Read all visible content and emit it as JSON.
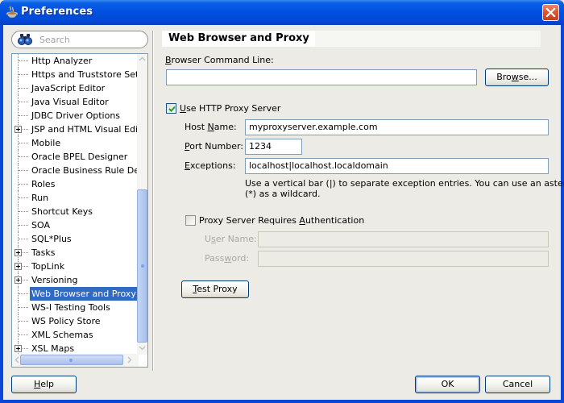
{
  "window": {
    "title": "Preferences",
    "icon": "java-coffee-cup-icon",
    "close_icon": "close-icon"
  },
  "search": {
    "placeholder": "Search",
    "icon": "binoculars-icon"
  },
  "tree": {
    "items": [
      {
        "label": "Http Analyzer",
        "expandable": false,
        "selected": false
      },
      {
        "label": "Https and Truststore Settin",
        "expandable": false,
        "selected": false
      },
      {
        "label": "JavaScript Editor",
        "expandable": false,
        "selected": false
      },
      {
        "label": "Java Visual Editor",
        "expandable": false,
        "selected": false
      },
      {
        "label": "JDBC Driver Options",
        "expandable": false,
        "selected": false
      },
      {
        "label": "JSP and HTML Visual Editor",
        "expandable": true,
        "selected": false
      },
      {
        "label": "Mobile",
        "expandable": false,
        "selected": false
      },
      {
        "label": "Oracle BPEL Designer",
        "expandable": false,
        "selected": false
      },
      {
        "label": "Oracle Business Rule Design",
        "expandable": false,
        "selected": false
      },
      {
        "label": "Roles",
        "expandable": false,
        "selected": false
      },
      {
        "label": "Run",
        "expandable": false,
        "selected": false
      },
      {
        "label": "Shortcut Keys",
        "expandable": false,
        "selected": false
      },
      {
        "label": "SOA",
        "expandable": false,
        "selected": false
      },
      {
        "label": "SQL*Plus",
        "expandable": false,
        "selected": false
      },
      {
        "label": "Tasks",
        "expandable": true,
        "selected": false
      },
      {
        "label": "TopLink",
        "expandable": true,
        "selected": false
      },
      {
        "label": "Versioning",
        "expandable": true,
        "selected": false
      },
      {
        "label": "Web Browser and Proxy",
        "expandable": false,
        "selected": true
      },
      {
        "label": "WS-I Testing Tools",
        "expandable": false,
        "selected": false
      },
      {
        "label": "WS Policy Store",
        "expandable": false,
        "selected": false
      },
      {
        "label": "XML Schemas",
        "expandable": false,
        "selected": false
      },
      {
        "label": "XSL Maps",
        "expandable": true,
        "selected": false
      }
    ]
  },
  "page": {
    "title": "Web Browser and Proxy",
    "browser_command_line": {
      "label_mnemonic": "B",
      "label_rest": "rowser Command Line:",
      "value": "",
      "browse_button": {
        "pre": "Bro",
        "mnemonic": "w",
        "post": "se..."
      }
    },
    "use_proxy": {
      "checked": true,
      "label_mnemonic": "U",
      "label_rest": "se HTTP Proxy Server"
    },
    "host_name": {
      "label_pre": "Host ",
      "label_mnemonic": "N",
      "label_post": "ame:",
      "value": "myproxyserver.example.com"
    },
    "port_number": {
      "label_mnemonic": "P",
      "label_post": "ort Number:",
      "value": "1234"
    },
    "exceptions": {
      "label_mnemonic": "E",
      "label_post": "xceptions:",
      "value": "localhost|localhost.localdomain",
      "hint_line1": "Use a vertical bar (|) to separate exception entries.  You can use an asterisk",
      "hint_line2": "(*) as a wildcard."
    },
    "requires_auth": {
      "checked": false,
      "label_pre": "Proxy Server Requires ",
      "label_mnemonic": "A",
      "label_post": "uthentication"
    },
    "user_name": {
      "label_pre": "U",
      "label_mnemonic": "s",
      "label_post": "er Name:",
      "value": "",
      "enabled": false
    },
    "password": {
      "label_pre": "Pass",
      "label_mnemonic": "w",
      "label_post": "ord:",
      "value": "",
      "enabled": false
    },
    "test_proxy_button": {
      "mnemonic": "T",
      "rest": "est Proxy"
    }
  },
  "footer": {
    "help_button": {
      "mnemonic": "H",
      "rest": "elp"
    },
    "ok_button": "OK",
    "cancel_button": "Cancel"
  },
  "colors": {
    "titlebar": "#0050e0",
    "selection": "#316ac5",
    "dialog_bg": "#ecebe6"
  }
}
